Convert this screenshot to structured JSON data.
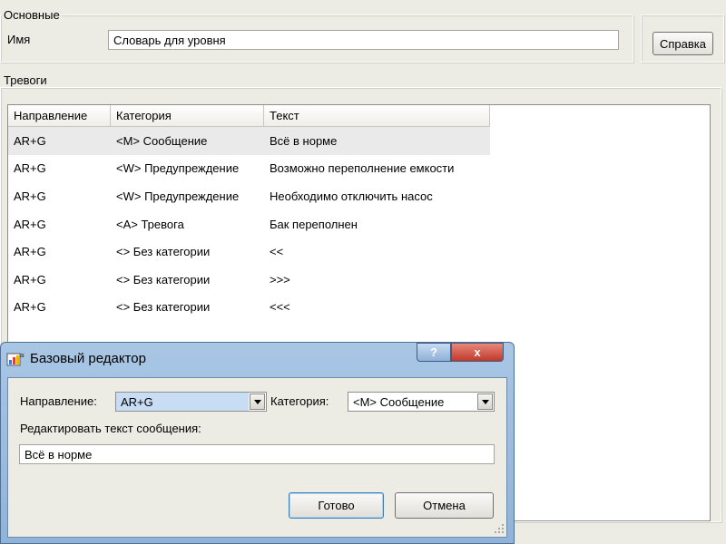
{
  "general_group": {
    "legend": "Основные",
    "name_label": "Имя",
    "name_value": "Словарь для уровня"
  },
  "help_button_label": "Справка",
  "alarms_group": {
    "legend": "Тревоги",
    "columns": [
      "Направление",
      "Категория",
      "Текст"
    ],
    "rows": [
      {
        "direction": "AR+G",
        "category": "<M> Сообщение",
        "text": "Всё в норме"
      },
      {
        "direction": "AR+G",
        "category": "<W> Предупреждение",
        "text": "Возможно переполнение емкости"
      },
      {
        "direction": "AR+G",
        "category": "<W> Предупреждение",
        "text": "Необходимо отключить насос"
      },
      {
        "direction": "AR+G",
        "category": "<A> Тревога",
        "text": "Бак переполнен"
      },
      {
        "direction": "AR+G",
        "category": "<> Без категории",
        "text": "<<"
      },
      {
        "direction": "AR+G",
        "category": "<> Без категории",
        "text": ">>>"
      },
      {
        "direction": "AR+G",
        "category": "<> Без категории",
        "text": "<<<"
      }
    ],
    "selected_row": 0
  },
  "dialog": {
    "title": "Базовый редактор",
    "help_glyph": "?",
    "close_glyph": "x",
    "direction_label": "Направление:",
    "direction_value": "AR+G",
    "category_label": "Категория:",
    "category_value": "<M> Сообщение",
    "edit_text_label": "Редактировать текст сообщения:",
    "message_text": "Всё в норме",
    "ok_label": "Готово",
    "cancel_label": "Отмена"
  },
  "colors": {
    "window_bg": "#ecebe4",
    "dialog_frame": "#9dbde0",
    "close_button": "#c9463d",
    "selected_row": "#eaeaea",
    "combo_selection": "#c8dcf4"
  }
}
